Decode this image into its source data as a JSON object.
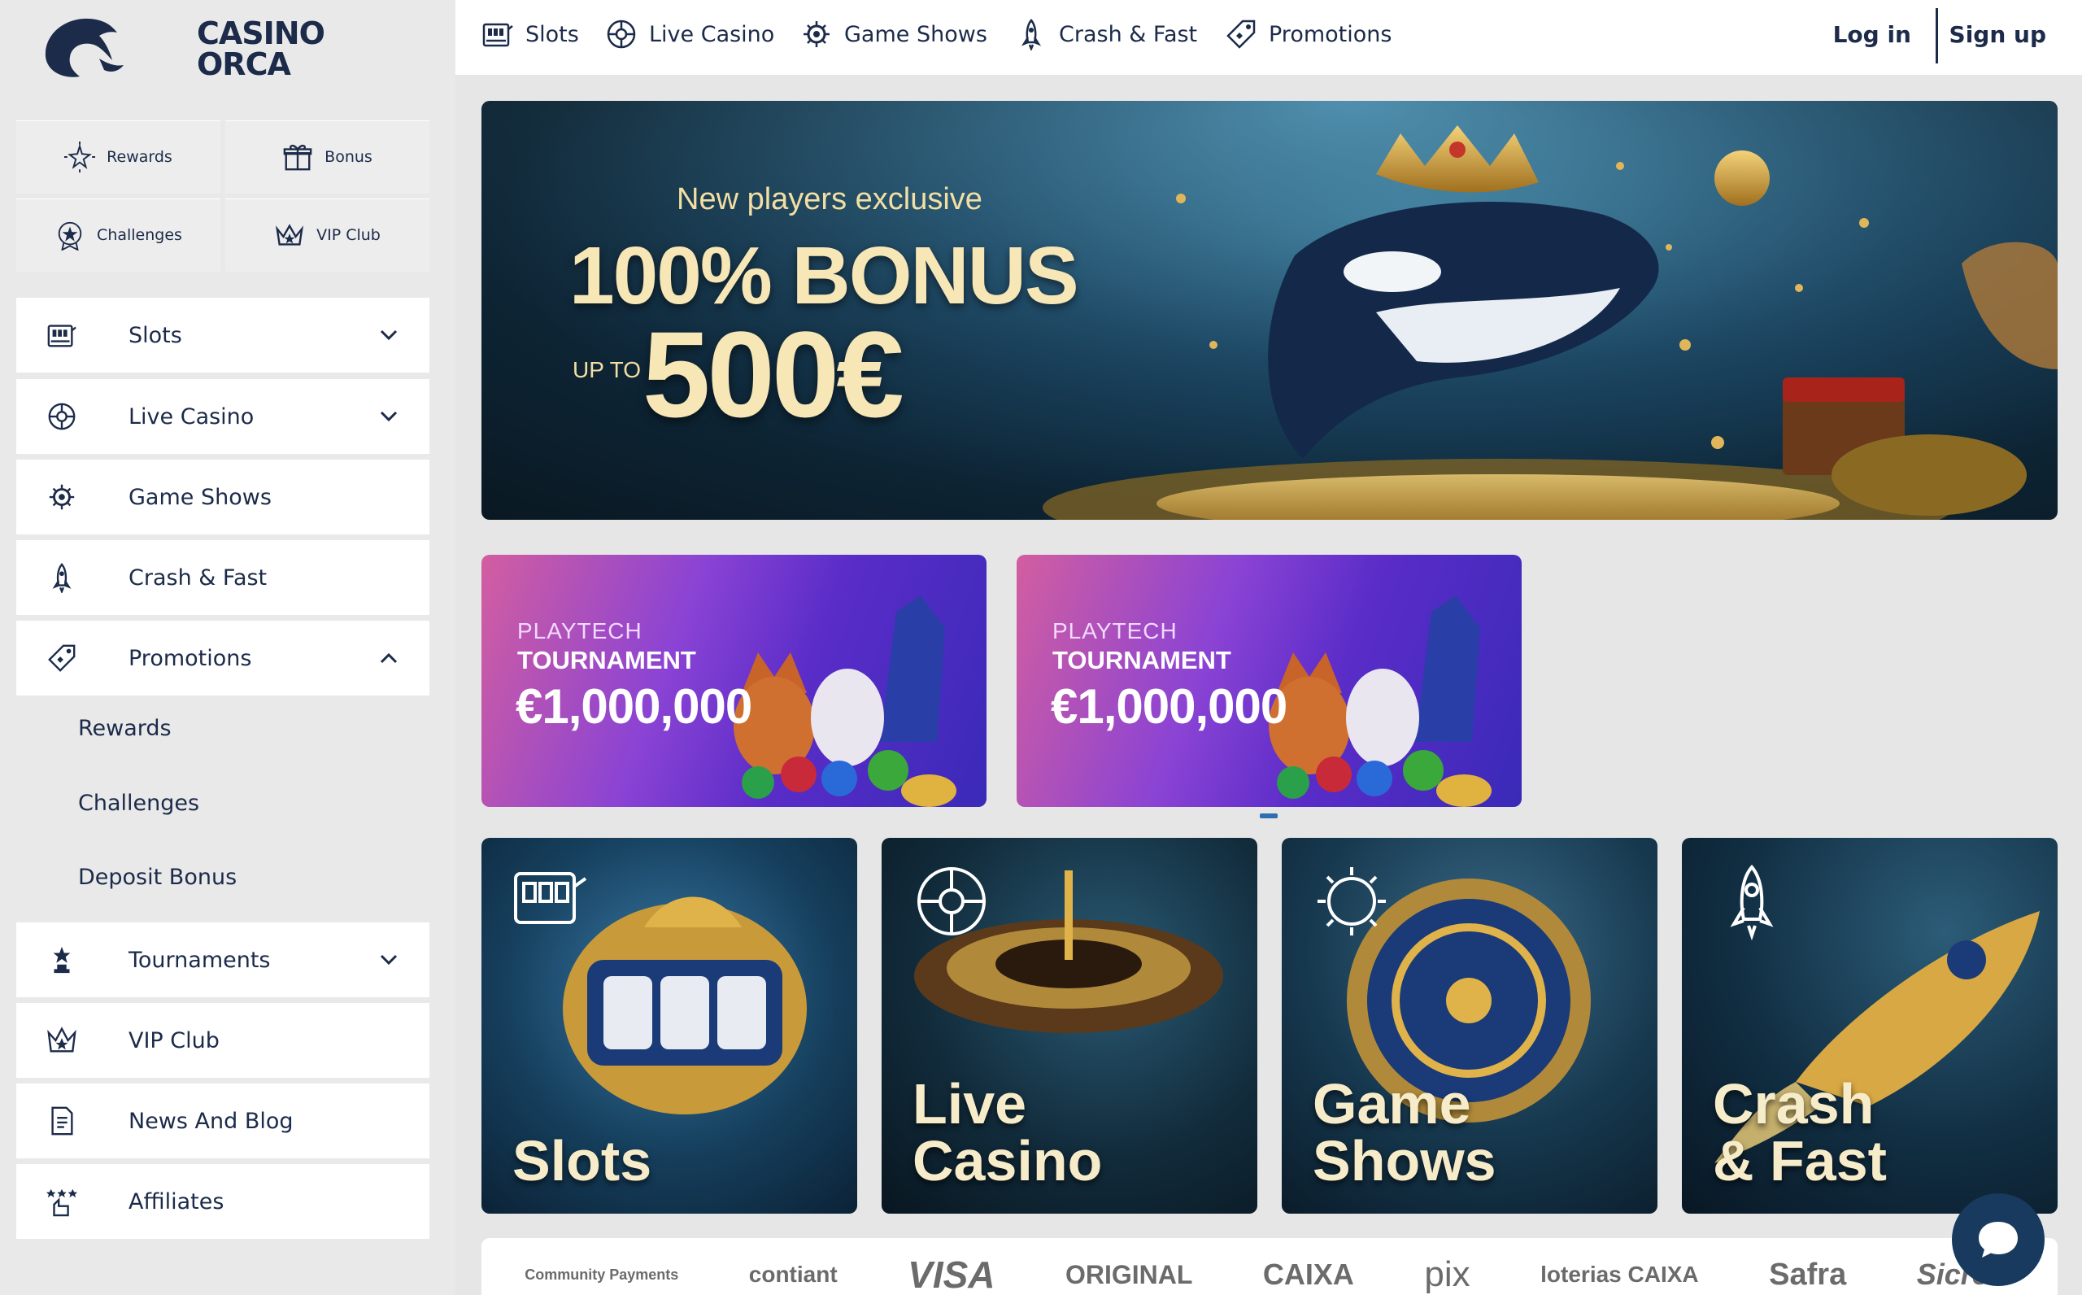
{
  "brand": {
    "name": "CASINO\nORCA"
  },
  "quick_links": [
    {
      "label": "Rewards",
      "icon": "star-burst-icon"
    },
    {
      "label": "Bonus",
      "icon": "gift-icon"
    },
    {
      "label": "Challenges",
      "icon": "badge-star-icon"
    },
    {
      "label": "VIP Club",
      "icon": "crown-icon"
    }
  ],
  "sidebar_menu": {
    "slots": "Slots",
    "live_casino": "Live Casino",
    "game_shows": "Game Shows",
    "crash_fast": "Crash & Fast",
    "promotions": "Promotions",
    "promotions_sub": [
      "Rewards",
      "Challenges",
      "Deposit Bonus"
    ],
    "tournaments": "Tournaments",
    "vip_club": "VIP Club",
    "news_blog": "News And Blog",
    "affiliates": "Affiliates"
  },
  "topnav": {
    "items": [
      "Slots",
      "Live Casino",
      "Game Shows",
      "Crash & Fast",
      "Promotions"
    ],
    "login": "Log in",
    "signup": "Sign up"
  },
  "hero": {
    "subtitle": "New players exclusive",
    "bonus": "100% BONUS",
    "upto": "UP TO",
    "amount": "500€"
  },
  "tournaments": [
    {
      "brand": "PLAYTECH",
      "title": "TOURNAMENT",
      "amount": "€1,000,000"
    },
    {
      "brand": "PLAYTECH",
      "title": "TOURNAMENT",
      "amount": "€1,000,000"
    }
  ],
  "categories": [
    {
      "label": "Slots"
    },
    {
      "label": "Live\nCasino"
    },
    {
      "label": "Game\nShows"
    },
    {
      "label": "Crash\n& Fast"
    }
  ],
  "payments": [
    "Community Payments",
    "contiant",
    "VISA",
    "ORIGINAL",
    "CAIXA",
    "pix",
    "loterias CAIXA",
    "Safra",
    "Sicredi"
  ],
  "colors": {
    "navy": "#1c2b4a",
    "sidebar_bg": "#e9e9e9",
    "content_bg": "#e6e6e6",
    "tournament_purple": "#5a2cc8",
    "gold": "#f7e6b6",
    "chat": "#173a5e"
  }
}
